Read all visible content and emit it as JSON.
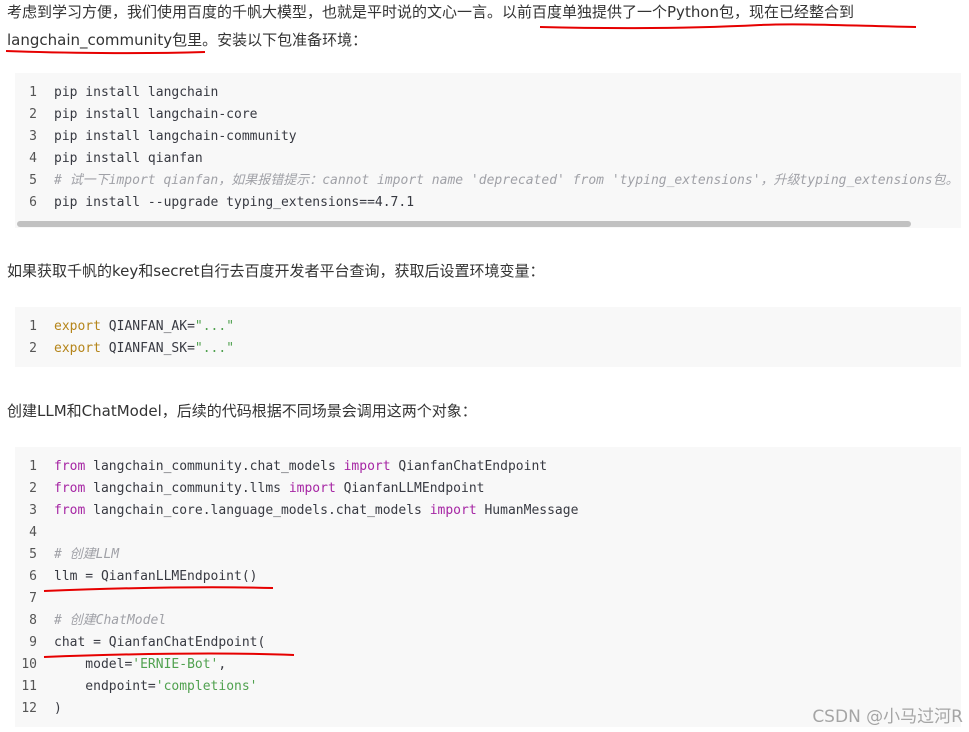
{
  "intro": {
    "text1": "考虑到学习方便，我们使用百度的千帆大模型，也就是平时说的文心一言。",
    "text2": "以前百度单独提供了一个Python包，现在已经整合到langchain_community包里",
    "text3": "。安装以下包准备环境："
  },
  "code1": {
    "lines": [
      {
        "n": "1",
        "t": "pip install langchain"
      },
      {
        "n": "2",
        "t": "pip install langchain-core"
      },
      {
        "n": "3",
        "t": "pip install langchain-community"
      },
      {
        "n": "4",
        "t": "pip install qianfan"
      },
      {
        "n": "5",
        "t": "# 试一下import qianfan，如果报错提示：cannot import name 'deprecated' from 'typing_extensions'，升级typing_extensions包。"
      },
      {
        "n": "6",
        "t": "pip install --upgrade typing_extensions==4.7.1"
      }
    ]
  },
  "para2": "如果获取千帆的key和secret自行去百度开发者平台查询，获取后设置环境变量：",
  "code2": {
    "export_kw": "export",
    "lines": [
      {
        "n": "1",
        "name": "QIANFAN_AK=",
        "val": "\"...\""
      },
      {
        "n": "2",
        "name": "QIANFAN_SK=",
        "val": "\"...\""
      }
    ]
  },
  "para3": "创建LLM和ChatModel，后续的代码根据不同场景会调用这两个对象：",
  "code3": {
    "kw_from": "from",
    "kw_import": "import",
    "imports": [
      {
        "n": "1",
        "mod": " langchain_community.chat_models ",
        "name": " QianfanChatEndpoint"
      },
      {
        "n": "2",
        "mod": " langchain_community.llms ",
        "name": " QianfanLLMEndpoint"
      },
      {
        "n": "3",
        "mod": " langchain_core.language_models.chat_models ",
        "name": " HumanMessage"
      }
    ],
    "n4": "4",
    "n5": "5",
    "c5": "# 创建LLM",
    "n6": "6",
    "l6": "llm = QianfanLLMEndpoint()",
    "n7": "7",
    "n8": "8",
    "c8": "# 创建ChatModel",
    "n9": "9",
    "l9": "chat = QianfanChatEndpoint(",
    "n10": "10",
    "l10a": "    model=",
    "l10s": "'ERNIE-Bot'",
    "l10b": ",",
    "n11": "11",
    "l11a": "    endpoint=",
    "l11s": "'completions'",
    "n12": "12",
    "l12": ")"
  },
  "watermark": "CSDN @小马过河R",
  "colors": {
    "annotation": "#e60000",
    "code_bg": "#f8f8f8",
    "keyword": "#a626a4",
    "string": "#50a14f"
  }
}
